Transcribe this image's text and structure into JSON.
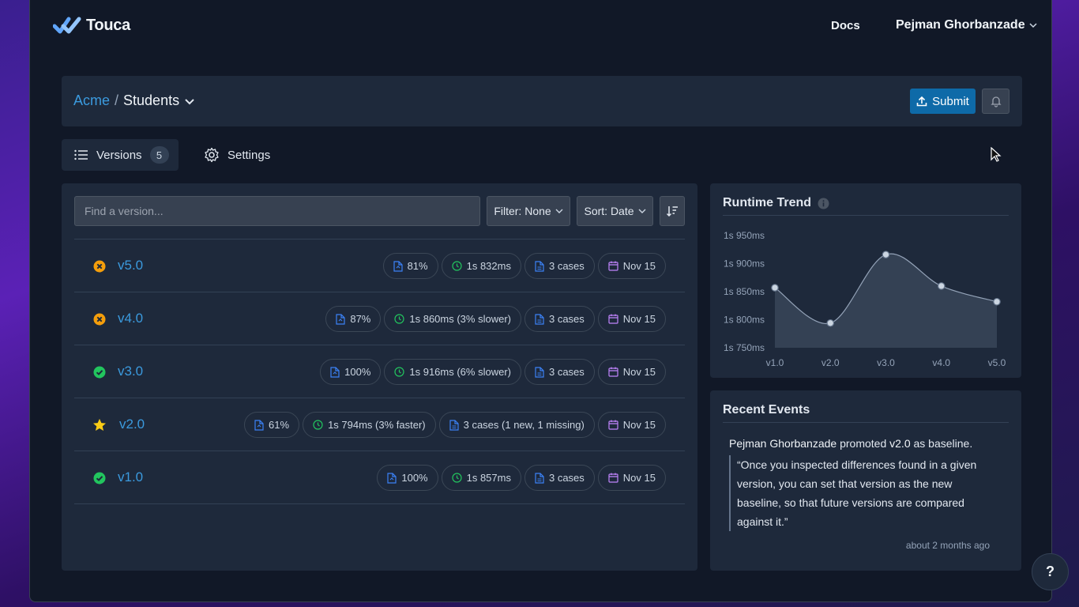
{
  "app": {
    "brand": "Touca"
  },
  "nav": {
    "docs": "Docs",
    "user": "Pejman Ghorbanzade"
  },
  "breadcrumb": {
    "team": "Acme",
    "separator": "/",
    "suite": "Students"
  },
  "header": {
    "submit_label": "Submit"
  },
  "tabs": {
    "versions_label": "Versions",
    "versions_count": "5",
    "settings_label": "Settings"
  },
  "toolbar": {
    "search_placeholder": "Find a version...",
    "filter_label": "Filter: None",
    "sort_label": "Sort: Date"
  },
  "versions": [
    {
      "name": "v5.0",
      "status": "failed",
      "score": "81%",
      "runtime": "1s 832ms",
      "cases": "3 cases",
      "date": "Nov 15"
    },
    {
      "name": "v4.0",
      "status": "failed",
      "score": "87%",
      "runtime": "1s 860ms (3% slower)",
      "cases": "3 cases",
      "date": "Nov 15"
    },
    {
      "name": "v3.0",
      "status": "passed",
      "score": "100%",
      "runtime": "1s 916ms (6% slower)",
      "cases": "3 cases",
      "date": "Nov 15"
    },
    {
      "name": "v2.0",
      "status": "baseline",
      "score": "61%",
      "runtime": "1s 794ms (3% faster)",
      "cases": "3 cases (1 new, 1 missing)",
      "date": "Nov 15"
    },
    {
      "name": "v1.0",
      "status": "passed",
      "score": "100%",
      "runtime": "1s 857ms",
      "cases": "3 cases",
      "date": "Nov 15"
    }
  ],
  "trend": {
    "title": "Runtime Trend",
    "y_ticks": [
      "1s 950ms",
      "1s 900ms",
      "1s 850ms",
      "1s 800ms",
      "1s 750ms"
    ]
  },
  "chart_data": {
    "type": "area",
    "title": "Runtime Trend",
    "categories": [
      "v1.0",
      "v2.0",
      "v3.0",
      "v4.0",
      "v5.0"
    ],
    "values": [
      1857,
      1794,
      1916,
      1860,
      1832
    ],
    "ylim": [
      1750,
      1950
    ],
    "ytick_values": [
      1950,
      1900,
      1850,
      1800,
      1750
    ],
    "grid": false
  },
  "events": {
    "title": "Recent Events",
    "actor": "Pejman Ghorbanzade",
    "action": " promoted ",
    "version": "v2.0",
    "suffix": " as baseline.",
    "quote": "“Once you inspected differences found in a given version, you can set that version as the new baseline, so that future versions are compared against it.”",
    "time": "about 2 months ago"
  },
  "help": {
    "label": "?"
  },
  "colors": {
    "accent": "#3b9ade",
    "submit": "#0e6aa8",
    "failed": "#f59e0b",
    "passed": "#22c55e",
    "baseline": "#facc15",
    "score_icon": "#3b82f6",
    "time_icon": "#22c55e",
    "date_icon": "#c084fc"
  }
}
